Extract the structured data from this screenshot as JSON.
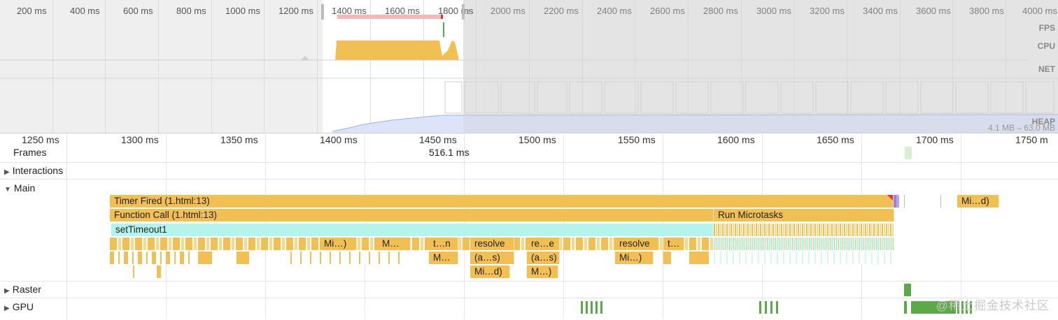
{
  "overview": {
    "ticks": [
      "200 ms",
      "400 ms",
      "600 ms",
      "800 ms",
      "1000 ms",
      "1200 ms",
      "1400 ms",
      "1600 ms",
      "1800 ms",
      "2000 ms",
      "2200 ms",
      "2400 ms",
      "2600 ms",
      "2800 ms",
      "3000 ms",
      "3200 ms",
      "3400 ms",
      "3600 ms",
      "3800 ms",
      "4000 ms"
    ],
    "tracks": {
      "fps": "FPS",
      "cpu": "CPU",
      "net": "NET",
      "heap": "HEAP"
    },
    "heap_range": "4.1 MB – 63.0 MB",
    "selection_truncated_label": "ns"
  },
  "ruler": {
    "ticks": [
      "1250 ms",
      "1300 ms",
      "1350 ms",
      "1400 ms",
      "1450 ms",
      "1500 ms",
      "1550 ms",
      "1600 ms",
      "1650 ms",
      "1700 ms",
      "1750 m"
    ],
    "frame_duration": "516.1 ms"
  },
  "tracks": {
    "frames": "Frames",
    "interactions": "Interactions",
    "main": "Main",
    "raster": "Raster",
    "gpu": "GPU",
    "expander_collapsed": "▶",
    "expander_expanded": "▼"
  },
  "events": {
    "timer_fired": "Timer Fired (1.html:13)",
    "function_call": "Function Call (1.html:13)",
    "run_microtasks": "Run Microtasks",
    "set_timeout": "setTimeout1",
    "mi_d_right": "Mi…d)",
    "l3_a": "Mi…)",
    "l3_b": "M…",
    "l3_c": "t…n",
    "l3_d": "resolve",
    "l3_e": "re…e",
    "l3_f": "resolve",
    "l3_g": "t…",
    "l4_a": "M…",
    "l4_b": "(a…s)",
    "l4_c": "(a…s)",
    "l4_d": "Mi…)",
    "l5_a": "Mi…d)",
    "l5_b": "M…)"
  },
  "watermark": "@稀土掘金技术社区",
  "colors": {
    "script": "#f2c052",
    "timer": "#b3f5ec",
    "gpu": "#5aab47",
    "fps": "#4caf50",
    "cpu_bar": "#f2c052",
    "heap": "#c8d6f5"
  }
}
